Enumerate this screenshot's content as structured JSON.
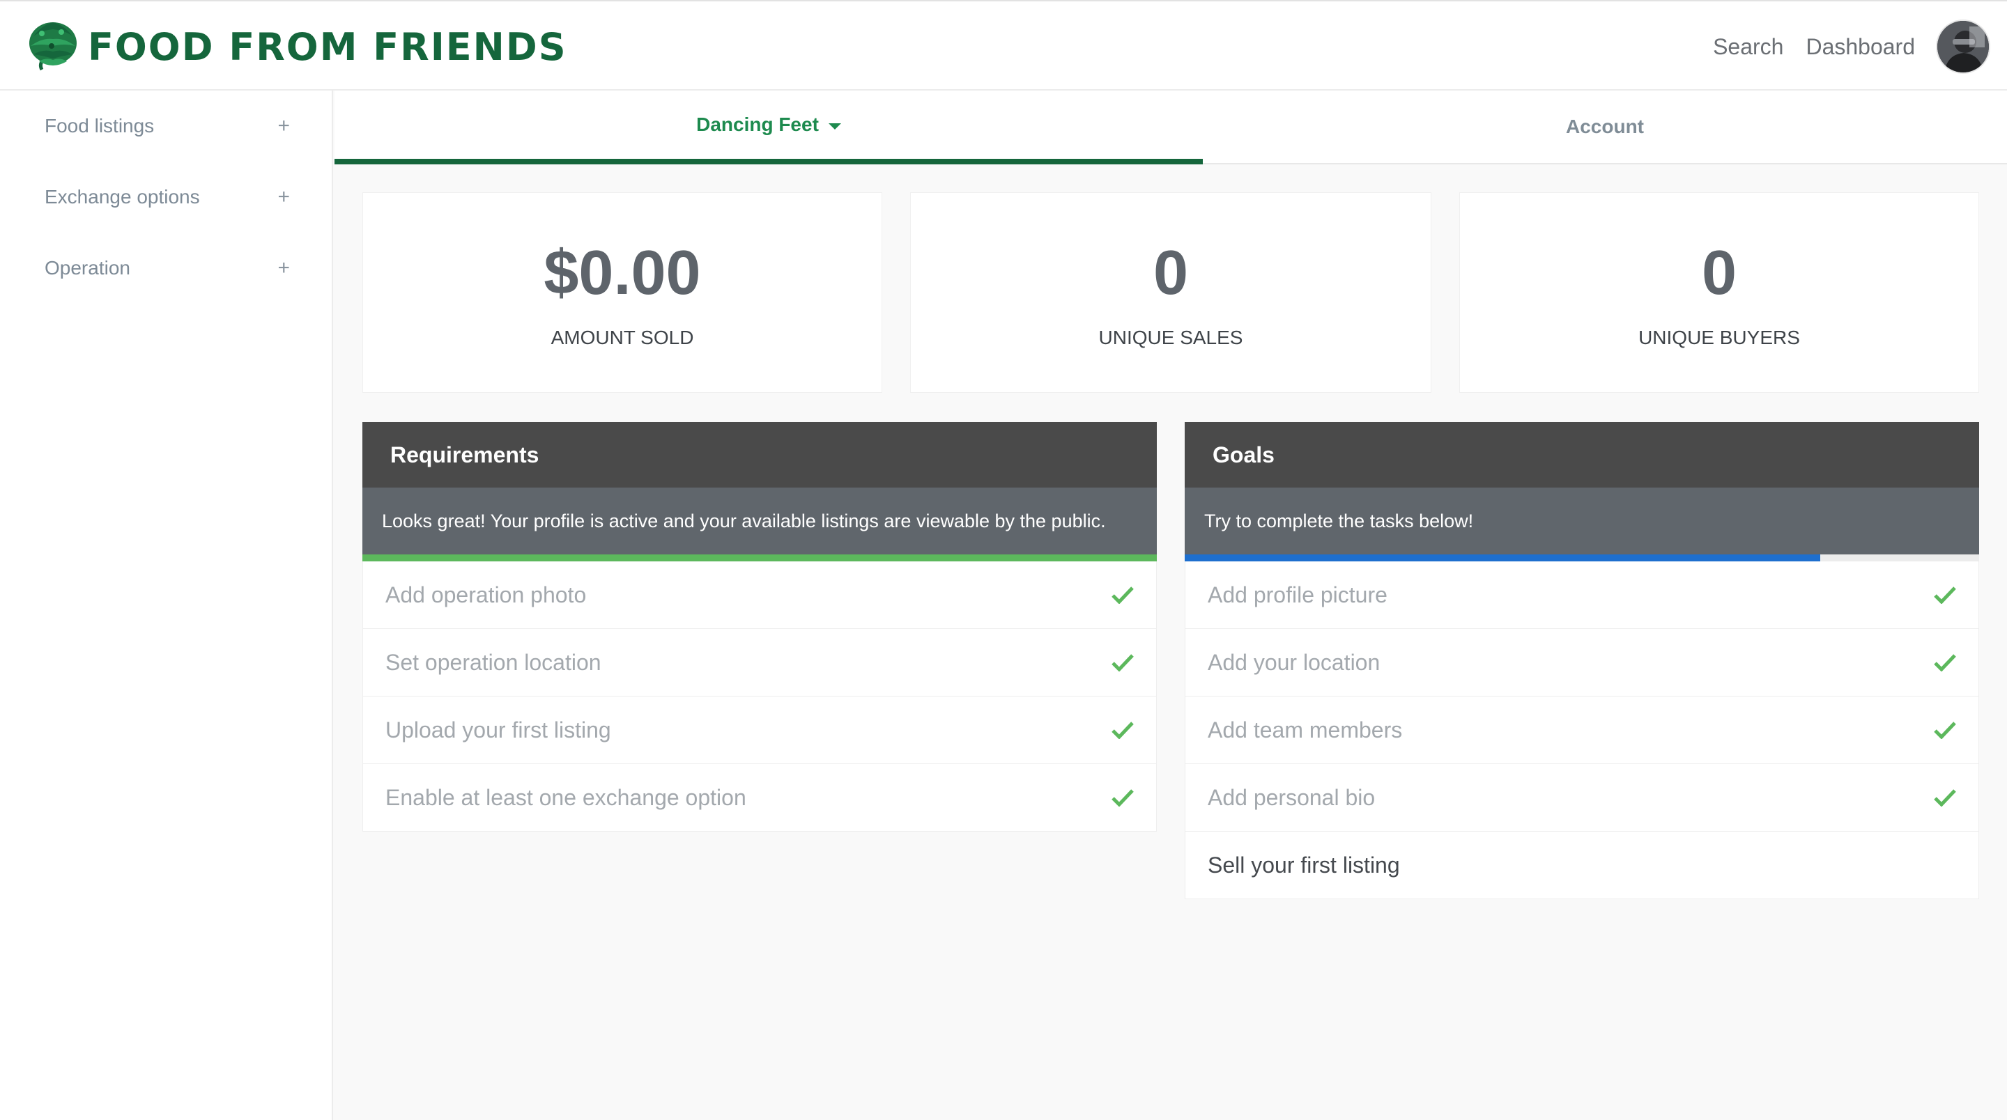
{
  "header": {
    "brand": "FOOD FROM FRIENDS",
    "nav": [
      "Search",
      "Dashboard"
    ]
  },
  "sidebar": {
    "items": [
      {
        "label": "Food listings",
        "icon": "+"
      },
      {
        "label": "Exchange options",
        "icon": "+"
      },
      {
        "label": "Operation",
        "icon": "+"
      }
    ]
  },
  "tabs": {
    "operation": "Dancing Feet",
    "account": "Account"
  },
  "stats": [
    {
      "value": "$0.00",
      "label": "AMOUNT SOLD"
    },
    {
      "value": "0",
      "label": "UNIQUE SALES"
    },
    {
      "value": "0",
      "label": "UNIQUE BUYERS"
    }
  ],
  "requirements": {
    "title": "Requirements",
    "message": "Looks great! Your profile is active and your available listings are viewable by the public.",
    "progress": 1.0,
    "progress_color": "#5cb85c",
    "items": [
      {
        "label": "Add operation photo",
        "done": true
      },
      {
        "label": "Set operation location",
        "done": true
      },
      {
        "label": "Upload your first listing",
        "done": true
      },
      {
        "label": "Enable at least one exchange option",
        "done": true
      }
    ]
  },
  "goals": {
    "title": "Goals",
    "message": "Try to complete the tasks below!",
    "progress": 0.8,
    "progress_color": "#1e6fce",
    "items": [
      {
        "label": "Add profile picture",
        "done": true
      },
      {
        "label": "Add your location",
        "done": true
      },
      {
        "label": "Add team members",
        "done": true
      },
      {
        "label": "Add personal bio",
        "done": true
      },
      {
        "label": "Sell your first listing",
        "done": false
      }
    ]
  },
  "colors": {
    "brand": "#15663c",
    "active_tab": "#1d8a4e",
    "check": "#5cb85c"
  }
}
